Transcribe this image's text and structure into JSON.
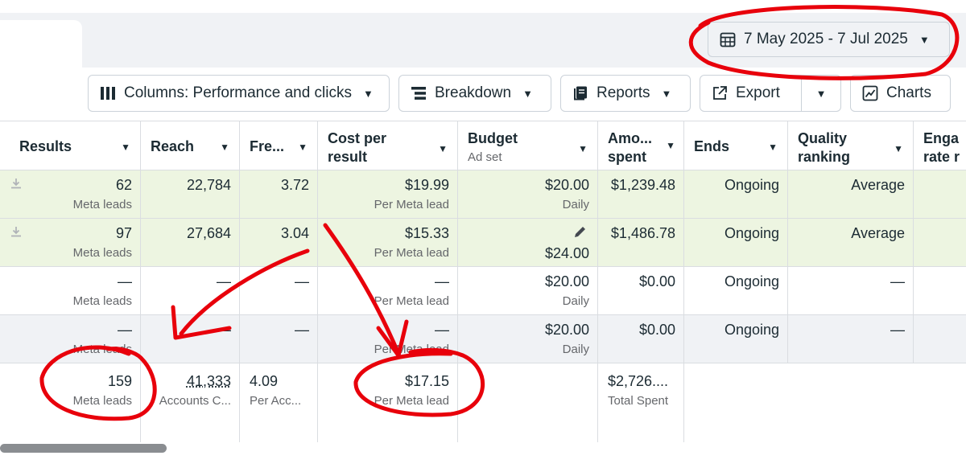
{
  "date_range": {
    "label": "7 May 2025 - 7 Jul 2025"
  },
  "toolbar": {
    "columns_label": "Columns: Performance and clicks",
    "breakdown_label": "Breakdown",
    "reports_label": "Reports",
    "export_label": "Export",
    "charts_label": "Charts"
  },
  "headers": {
    "results": "Results",
    "reach": "Reach",
    "frequency": "Fre...",
    "cost_line1": "Cost per",
    "cost_line2": "result",
    "budget": "Budget",
    "budget_sub": "Ad set",
    "amount_line1": "Amo...",
    "amount_line2": "spent",
    "ends": "Ends",
    "quality_line1": "Quality",
    "quality_line2": "ranking",
    "eng_line1": "Enga",
    "eng_line2": "rate r"
  },
  "rows": [
    {
      "results": "62",
      "results_sub": "Meta leads",
      "reach": "22,784",
      "frequency": "3.72",
      "cost": "$19.99",
      "cost_sub": "Per Meta lead",
      "budget": "$20.00",
      "budget_sub": "Daily",
      "amount": "$1,239.48",
      "ends": "Ongoing",
      "quality": "Average"
    },
    {
      "results": "97",
      "results_sub": "Meta leads",
      "reach": "27,684",
      "frequency": "3.04",
      "cost": "$15.33",
      "cost_sub": "Per Meta lead",
      "budget": "$24.00",
      "amount": "$1,486.78",
      "ends": "Ongoing",
      "quality": "Average"
    },
    {
      "results": "—",
      "results_sub": "Meta leads",
      "reach": "—",
      "frequency": "—",
      "cost": "—",
      "cost_sub": "Per Meta lead",
      "budget": "$20.00",
      "budget_sub": "Daily",
      "amount": "$0.00",
      "ends": "Ongoing",
      "quality": "—"
    },
    {
      "results": "—",
      "results_sub": "Meta leads",
      "reach": "—",
      "frequency": "—",
      "cost": "—",
      "cost_sub": "Per Meta lead",
      "budget": "$20.00",
      "budget_sub": "Daily",
      "amount": "$0.00",
      "ends": "Ongoing",
      "quality": "—"
    }
  ],
  "totals": {
    "results": "159",
    "results_sub": "Meta leads",
    "reach": "41,333",
    "reach_sub": "Accounts C...",
    "frequency": "4.09",
    "frequency_sub": "Per Acc...",
    "cost": "$17.15",
    "cost_sub": "Per Meta lead",
    "amount": "$2,726....",
    "amount_sub": "Total Spent"
  },
  "colors": {
    "selected_row": "#edf5e1",
    "border": "#dadde1",
    "annotation": "#e8000b"
  }
}
